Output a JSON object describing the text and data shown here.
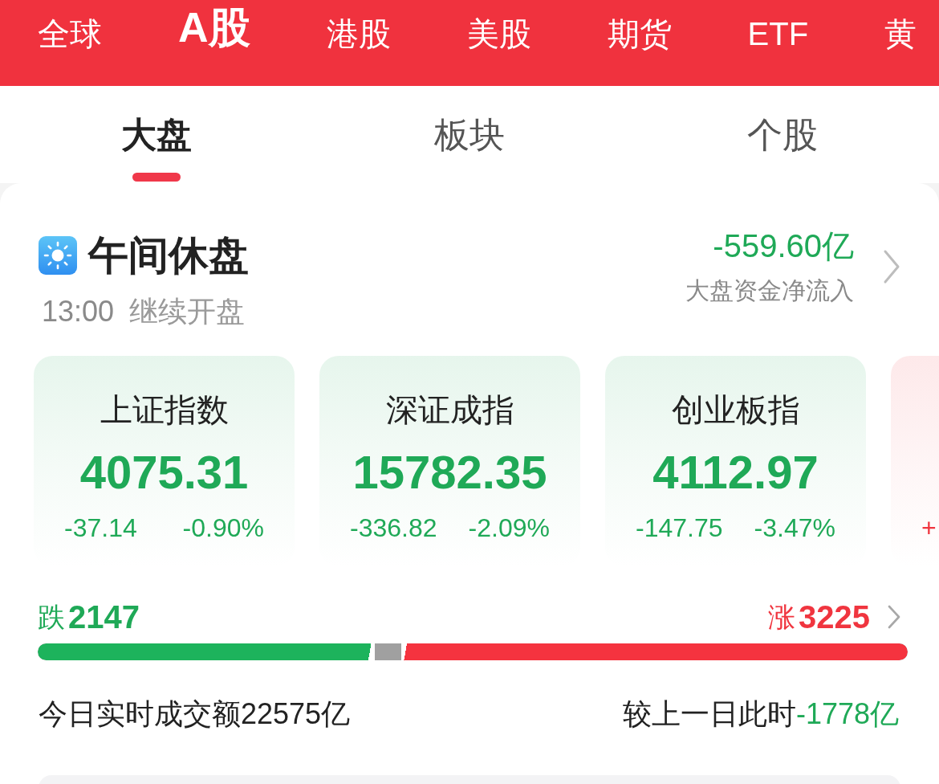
{
  "market_tabs": [
    {
      "label": "全球",
      "selected": false
    },
    {
      "label": "A股",
      "selected": true
    },
    {
      "label": "港股",
      "selected": false
    },
    {
      "label": "美股",
      "selected": false
    },
    {
      "label": "期货",
      "selected": false
    },
    {
      "label": "ETF",
      "selected": false
    },
    {
      "label": "黄",
      "selected": false
    }
  ],
  "view_tabs": [
    {
      "label": "大盘",
      "selected": true
    },
    {
      "label": "板块",
      "selected": false
    },
    {
      "label": "个股",
      "selected": false
    }
  ],
  "session": {
    "status": "午间休盘",
    "resume_time": "13:00",
    "resume_label": "继续开盘"
  },
  "net_inflow": {
    "value": "-559.60亿",
    "label": "大盘资金净流入"
  },
  "indices": [
    {
      "name": "上证指数",
      "value": "4075.31",
      "change": "-37.14",
      "percent": "-0.90%",
      "color": "#1fa957"
    },
    {
      "name": "深证成指",
      "value": "15782.35",
      "change": "-336.82",
      "percent": "-2.09%",
      "color": "#1fa957"
    },
    {
      "name": "创业板指",
      "value": "4112.97",
      "change": "-147.75",
      "percent": "-3.47%",
      "color": "#1fa957"
    },
    {
      "change": "+",
      "color": "#f0353f"
    }
  ],
  "breadth": {
    "fall_label": "跌",
    "fall_count": "2147",
    "rise_label": "涨",
    "rise_count": "3225",
    "fall_bar": {
      "level": 0.387
    },
    "rise_bar": {
      "level": 0.582
    }
  },
  "turnover": {
    "text": "今日实时成交额22575亿",
    "compare_label": "较上一日此时",
    "compare_value": "-1778亿"
  }
}
